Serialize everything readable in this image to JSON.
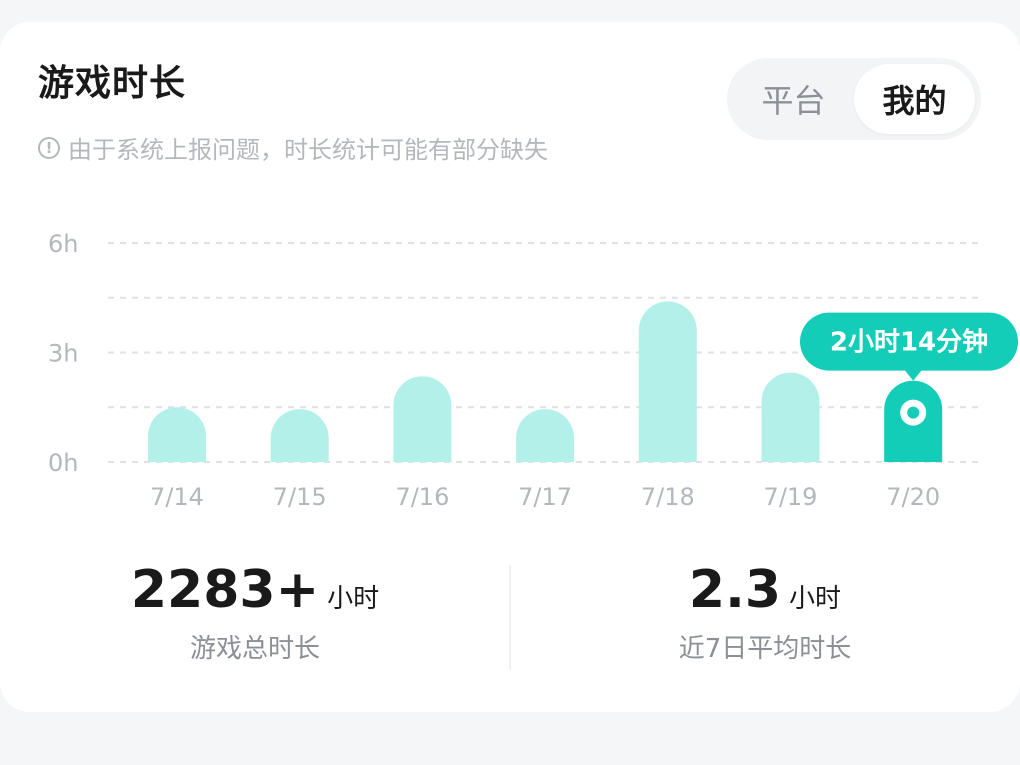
{
  "header": {
    "title": "游戏时长",
    "notice_icon": "info-icon",
    "notice": "由于系统上报问题，时长统计可能有部分缺失"
  },
  "toggle": {
    "options": [
      "平台",
      "我的"
    ],
    "selected": "我的"
  },
  "chart_data": {
    "type": "bar",
    "categories": [
      "7/14",
      "7/15",
      "7/16",
      "7/17",
      "7/18",
      "7/19",
      "7/20"
    ],
    "values": [
      1.5,
      1.45,
      2.35,
      1.45,
      4.4,
      2.45,
      2.23
    ],
    "highlight_index": 6,
    "tooltip": "2小时14分钟",
    "yticks": [
      "0h",
      "3h",
      "6h"
    ],
    "ylim": [
      0,
      6
    ],
    "grid": true,
    "colors": {
      "bar": "#b3f0ea",
      "highlight": "#14cdb8",
      "grid": "#dfe1e4",
      "tick": "#b4b7bc"
    }
  },
  "stats": {
    "total": {
      "value": "2283+",
      "unit": "小时",
      "label": "游戏总时长"
    },
    "average": {
      "value": "2.3",
      "unit": "小时",
      "label": "近7日平均时长"
    }
  }
}
